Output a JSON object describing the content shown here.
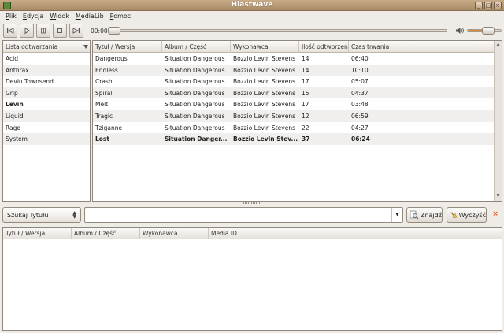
{
  "window": {
    "title": "Hiastwave",
    "minimize": "_",
    "maximize": "□",
    "close": "×"
  },
  "menu": [
    "Plik",
    "Edycja",
    "Widok",
    "MediaLib",
    "Pomoc"
  ],
  "player": {
    "time": "00:00",
    "volume_fraction": 0.62
  },
  "playlists": {
    "header": "Lista odtwarzania",
    "items": [
      {
        "name": "Acid",
        "active": false
      },
      {
        "name": "Anthrax",
        "active": false
      },
      {
        "name": "Devin Townsend",
        "active": false
      },
      {
        "name": "Grip",
        "active": false
      },
      {
        "name": "Levin",
        "active": true
      },
      {
        "name": "Liquid",
        "active": false
      },
      {
        "name": "Rage",
        "active": false
      },
      {
        "name": "System",
        "active": false
      }
    ]
  },
  "tracks": {
    "columns": [
      "Tytuł / Wersja",
      "Album / Część",
      "Wykonawca",
      "Ilość odtworzeń",
      "Czas trwania"
    ],
    "rows": [
      {
        "title": "Dangerous",
        "album": "Situation Dangerous",
        "artist": "Bozzio Levin Stevens",
        "plays": "14",
        "duration": "06:40",
        "current": false
      },
      {
        "title": "Endless",
        "album": "Situation Dangerous",
        "artist": "Bozzio Levin Stevens",
        "plays": "14",
        "duration": "10:10",
        "current": false
      },
      {
        "title": "Crash",
        "album": "Situation Dangerous",
        "artist": "Bozzio Levin Stevens",
        "plays": "17",
        "duration": "05:07",
        "current": false
      },
      {
        "title": "Spiral",
        "album": "Situation Dangerous",
        "artist": "Bozzio Levin Stevens",
        "plays": "15",
        "duration": "04:37",
        "current": false
      },
      {
        "title": "Melt",
        "album": "Situation Dangerous",
        "artist": "Bozzio Levin Stevens",
        "plays": "17",
        "duration": "03:48",
        "current": false
      },
      {
        "title": "Tragic",
        "album": "Situation Dangerous",
        "artist": "Bozzio Levin Stevens",
        "plays": "12",
        "duration": "06:59",
        "current": false
      },
      {
        "title": "Tziganne",
        "album": "Situation Dangerous",
        "artist": "Bozzio Levin Stevens",
        "plays": "22",
        "duration": "04:27",
        "current": false
      },
      {
        "title": "Lost",
        "album": "Situation Danger...",
        "artist": "Bozzio Levin Stev...",
        "plays": "37",
        "duration": "06:24",
        "current": true
      }
    ]
  },
  "search": {
    "field_select": "Szukaj Tytułu",
    "query": "",
    "placeholder": "",
    "find_label": "Znajdź",
    "clear_label": "Wyczyść"
  },
  "results": {
    "columns": [
      "Tytuł / Wersja",
      "Album / Część",
      "Wykonawca",
      "Media ID"
    ]
  },
  "colors": {
    "accent": "#e38a2b",
    "titlebar": "#b89a74"
  }
}
